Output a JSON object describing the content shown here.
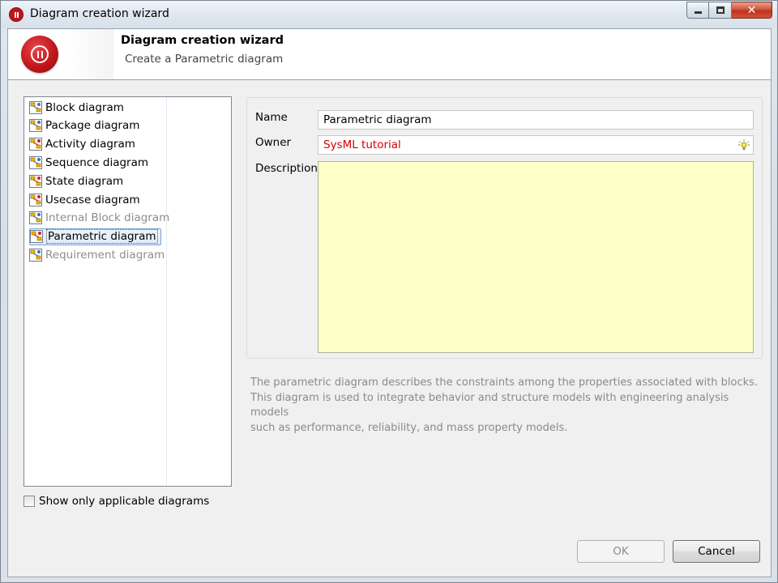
{
  "window": {
    "title": "Diagram creation wizard",
    "close_glyph": "✕"
  },
  "banner": {
    "title": "Diagram creation wizard",
    "subtitle": "Create a Parametric diagram"
  },
  "diagram_types": [
    {
      "label": "Block diagram",
      "icon": "block-diagram-icon",
      "enabled": true,
      "selected": false
    },
    {
      "label": "Package diagram",
      "icon": "package-diagram-icon",
      "enabled": true,
      "selected": false
    },
    {
      "label": "Activity diagram",
      "icon": "activity-diagram-icon",
      "enabled": true,
      "selected": false
    },
    {
      "label": "Sequence diagram",
      "icon": "sequence-diagram-icon",
      "enabled": true,
      "selected": false
    },
    {
      "label": "State diagram",
      "icon": "state-diagram-icon",
      "enabled": true,
      "selected": false
    },
    {
      "label": "Usecase diagram",
      "icon": "usecase-diagram-icon",
      "enabled": true,
      "selected": false
    },
    {
      "label": "Internal Block diagram",
      "icon": "internal-block-diagram-icon",
      "enabled": false,
      "selected": false
    },
    {
      "label": "Parametric diagram",
      "icon": "parametric-diagram-icon",
      "enabled": true,
      "selected": true
    },
    {
      "label": "Requirement diagram",
      "icon": "requirement-diagram-icon",
      "enabled": false,
      "selected": false
    }
  ],
  "show_only_applicable": {
    "label": "Show only applicable diagrams",
    "checked": false
  },
  "form": {
    "name_label": "Name",
    "name_value": "Parametric diagram",
    "owner_label": "Owner",
    "owner_value": "SysML tutorial",
    "description_label": "Description",
    "description_value": ""
  },
  "help_lines": [
    "The parametric diagram describes the constraints among the properties associated with blocks.",
    "This diagram is used to integrate behavior and structure models with engineering analysis models",
    "such as performance, reliability, and mass property models."
  ],
  "buttons": {
    "ok_label": "OK",
    "ok_enabled": false,
    "cancel_label": "Cancel"
  },
  "colors": {
    "owner_text": "#d40000",
    "description_bg": "#ffffc8",
    "disabled_text": "#8d8d8d",
    "brand_red": "#c2161c"
  }
}
